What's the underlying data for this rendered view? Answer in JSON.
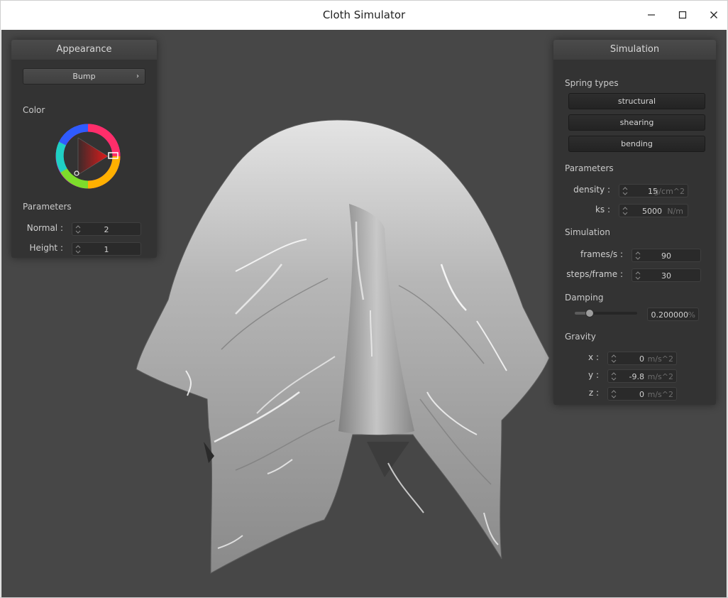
{
  "window": {
    "title": "Cloth Simulator"
  },
  "appearance": {
    "title": "Appearance",
    "shader_button": "Bump",
    "color_label": "Color",
    "params_label": "Parameters",
    "normal_label": "Normal :",
    "normal_value": "2",
    "height_label": "Height :",
    "height_value": "1"
  },
  "simulation": {
    "title": "Simulation",
    "spring_types_label": "Spring types",
    "springs": [
      "structural",
      "shearing",
      "bending"
    ],
    "params_label": "Parameters",
    "density_label": "density :",
    "density_value": "15",
    "density_unit": "g/cm^2",
    "ks_label": "ks :",
    "ks_value": "5000",
    "ks_unit": "N/m",
    "sim_label": "Simulation",
    "fps_label": "frames/s :",
    "fps_value": "90",
    "spf_label": "steps/frame :",
    "spf_value": "30",
    "damping_label": "Damping",
    "damping_value": "0.200000",
    "damping_unit": "%",
    "damping_fraction": 0.2,
    "gravity_label": "Gravity",
    "gx_label": "x :",
    "gx_value": "0",
    "gy_label": "y :",
    "gy_value": "-9.8",
    "gz_label": "z :",
    "gz_value": "0",
    "gravity_unit": "m/s^2"
  },
  "icons": {
    "minimize": "minimize-icon",
    "maximize": "maximize-icon",
    "close": "close-icon",
    "chevron": "chevron-right-icon"
  },
  "colors": {
    "viewport_bg": "#474747",
    "panel_bg": "#333333",
    "selected_color": "#cc2020"
  }
}
